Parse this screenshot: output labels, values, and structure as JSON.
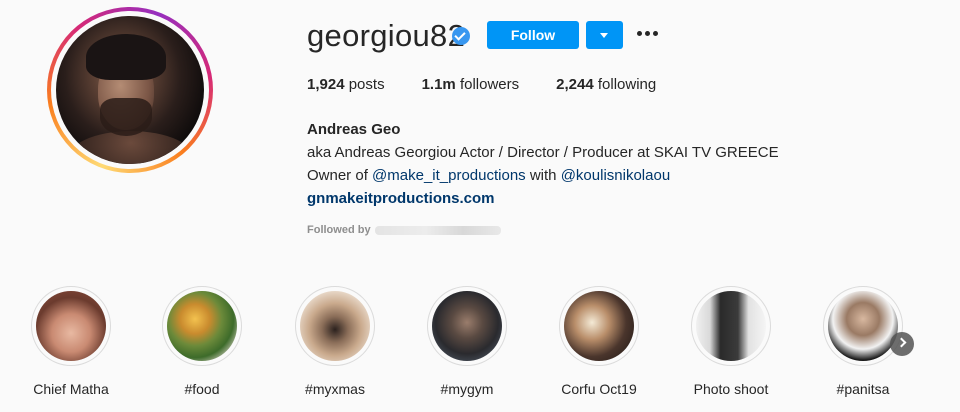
{
  "profile": {
    "username": "georgiou82",
    "follow_label": "Follow",
    "stats": [
      {
        "value": "1,924",
        "label": "posts"
      },
      {
        "value": "1.1m",
        "label": "followers"
      },
      {
        "value": "2,244",
        "label": "following"
      }
    ],
    "full_name": "Andreas Geo",
    "bio_line1": "aka Andreas Georgiou Actor / Director / Producer at SKAI TV GREECE",
    "bio_owner_prefix": "Owner of",
    "bio_mention1": "@make_it_productions",
    "bio_with": "with",
    "bio_mention2": "@koulisnikolaou",
    "website": "gnmakeitproductions.com",
    "followed_by": "Followed by"
  },
  "highlights": [
    {
      "label": "Chief Matha"
    },
    {
      "label": "#food"
    },
    {
      "label": "#myxmas"
    },
    {
      "label": "#mygym"
    },
    {
      "label": "Corfu Oct19"
    },
    {
      "label": "Photo shoot"
    },
    {
      "label": "#panitsa"
    }
  ],
  "colors": {
    "accent": "#0095f6",
    "verified": "#3897f0",
    "link": "#00376b",
    "text": "#262626",
    "muted": "#8e8e8e"
  },
  "icons": [
    "verified-badge-icon",
    "chevron-down-icon",
    "more-options-icon",
    "chevron-right-icon"
  ]
}
